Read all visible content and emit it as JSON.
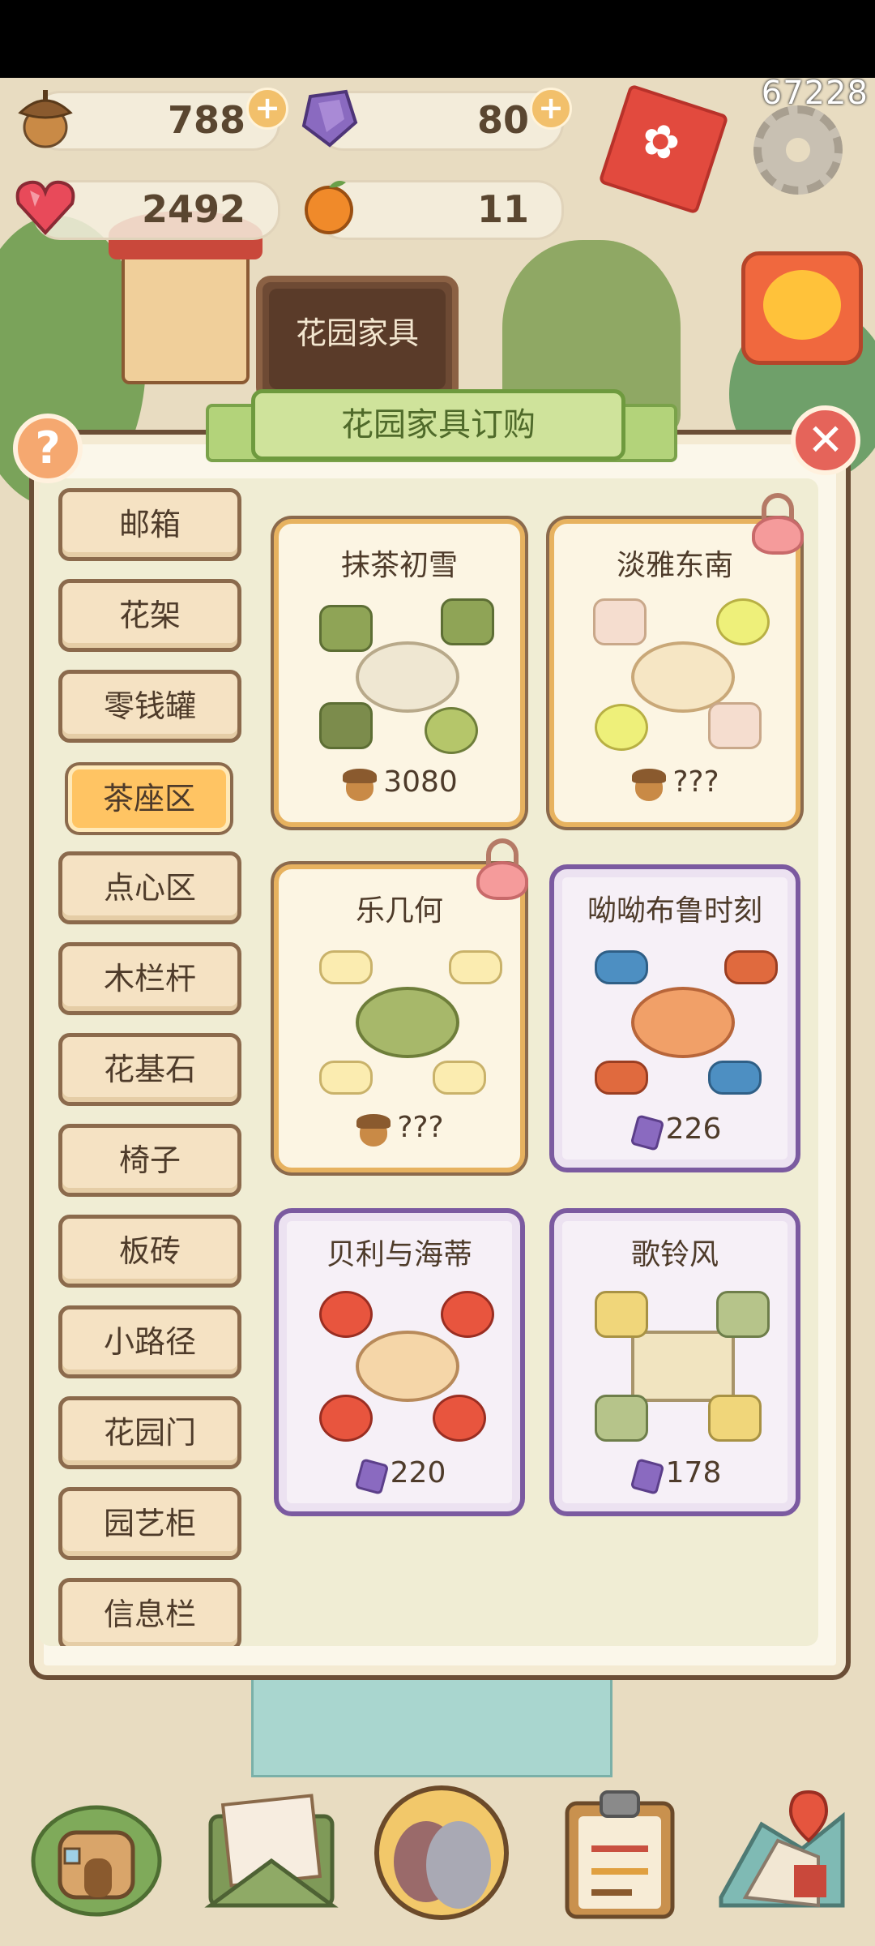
{
  "score": "67228",
  "currency": {
    "acorns": "788",
    "gems": "80",
    "hearts": "2492",
    "oranges": "11"
  },
  "sign": "花园家具",
  "panel": {
    "title": "花园家具订购"
  },
  "categories": [
    "邮箱",
    "花架",
    "零钱罐",
    "茶座区",
    "点心区",
    "木栏杆",
    "花基石",
    "椅子",
    "板砖",
    "小路径",
    "花园门",
    "园艺柜",
    "信息栏"
  ],
  "selected_category": "茶座区",
  "items": [
    {
      "name": "抹茶初雪",
      "price": "3080",
      "currency": "acorn",
      "locked": false,
      "style": "normal"
    },
    {
      "name": "淡雅东南",
      "price": "???",
      "currency": "acorn",
      "locked": true,
      "style": "normal"
    },
    {
      "name": "乐几何",
      "price": "???",
      "currency": "acorn",
      "locked": true,
      "style": "normal"
    },
    {
      "name": "呦呦布鲁时刻",
      "price": "226",
      "currency": "gem",
      "locked": false,
      "style": "premium"
    },
    {
      "name": "贝利与海蒂",
      "price": "220",
      "currency": "gem",
      "locked": false,
      "style": "premium"
    },
    {
      "name": "歌铃风",
      "price": "178",
      "currency": "gem",
      "locked": false,
      "style": "premium"
    }
  ],
  "bottom_nav": [
    "house-icon",
    "mail-icon",
    "birds-icon",
    "clipboard-icon",
    "map-icon"
  ],
  "colors": {
    "selected_category": "#ffc463",
    "premium_border": "#7b5aa0",
    "normal_border": "#e7b25f",
    "banner": "#cfe39b"
  }
}
